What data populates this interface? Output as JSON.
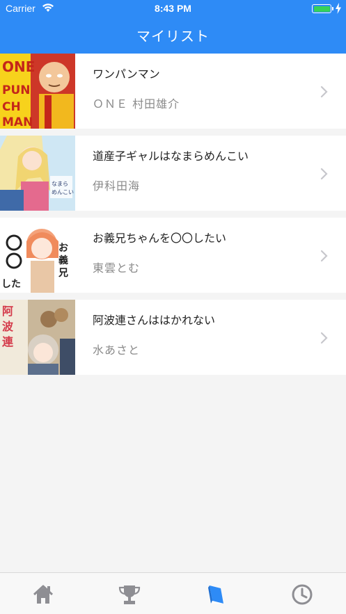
{
  "status_bar": {
    "carrier": "Carrier",
    "time": "8:43 PM",
    "battery_level": 1.0,
    "battery_color": "#37d259"
  },
  "nav": {
    "title": "マイリスト",
    "background": "#2e8bf6"
  },
  "list": [
    {
      "title": "ワンパンマン",
      "author": "ＯＮＥ 村田雄介",
      "cover_icon": "one-punch-man-cover"
    },
    {
      "title": "道産子ギャルはなまらめんこい",
      "author": "伊科田海",
      "cover_icon": "dosanko-gal-cover"
    },
    {
      "title": "お義兄ちゃんを〇〇したい",
      "author": "東雲とむ",
      "cover_icon": "oniichan-cover"
    },
    {
      "title": "阿波連さんははかれない",
      "author": "水あさと",
      "cover_icon": "aharen-san-cover"
    }
  ],
  "tabbar": {
    "tabs": [
      {
        "name": "home",
        "icon": "home-icon",
        "active": false
      },
      {
        "name": "ranking",
        "icon": "trophy-icon",
        "active": false
      },
      {
        "name": "mylist",
        "icon": "book-icon",
        "active": true
      },
      {
        "name": "history",
        "icon": "clock-icon",
        "active": false
      }
    ],
    "active_color": "#2e8bf6",
    "inactive_color": "#8e8e93"
  }
}
